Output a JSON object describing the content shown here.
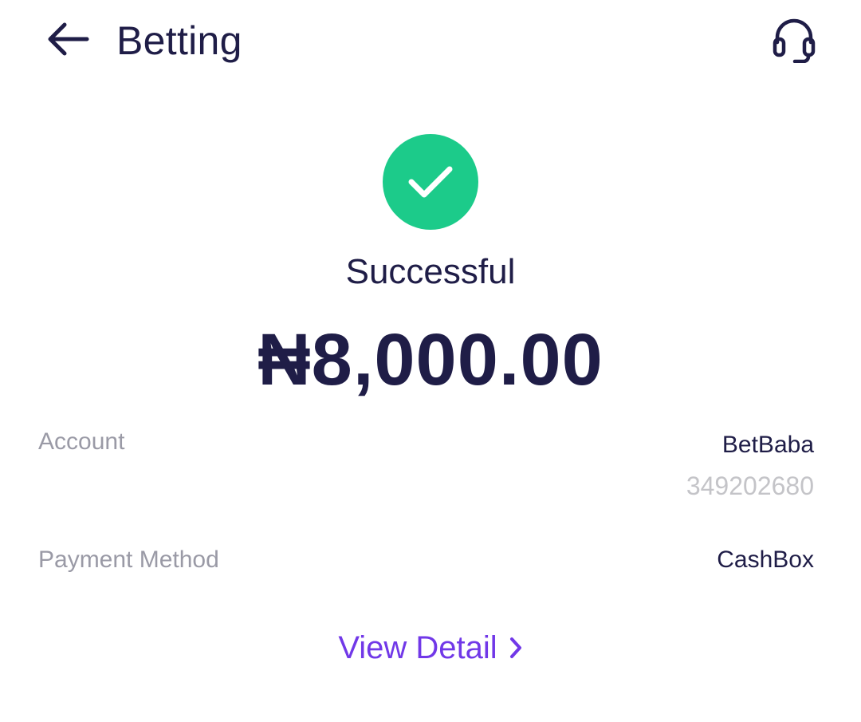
{
  "header": {
    "title": "Betting",
    "back_icon": "arrow-left-icon",
    "support_icon": "headset-icon"
  },
  "status": {
    "icon": "check-icon",
    "label": "Successful",
    "color": "#1ccb8a"
  },
  "amount": "₦8,000.00",
  "details": {
    "account": {
      "label": "Account",
      "value": "BetBaba",
      "subvalue": "349202680"
    },
    "payment_method": {
      "label": "Payment Method",
      "value": "CashBox"
    }
  },
  "view_detail": {
    "label": "View Detail",
    "icon": "chevron-right-icon",
    "color": "#7138e8"
  }
}
